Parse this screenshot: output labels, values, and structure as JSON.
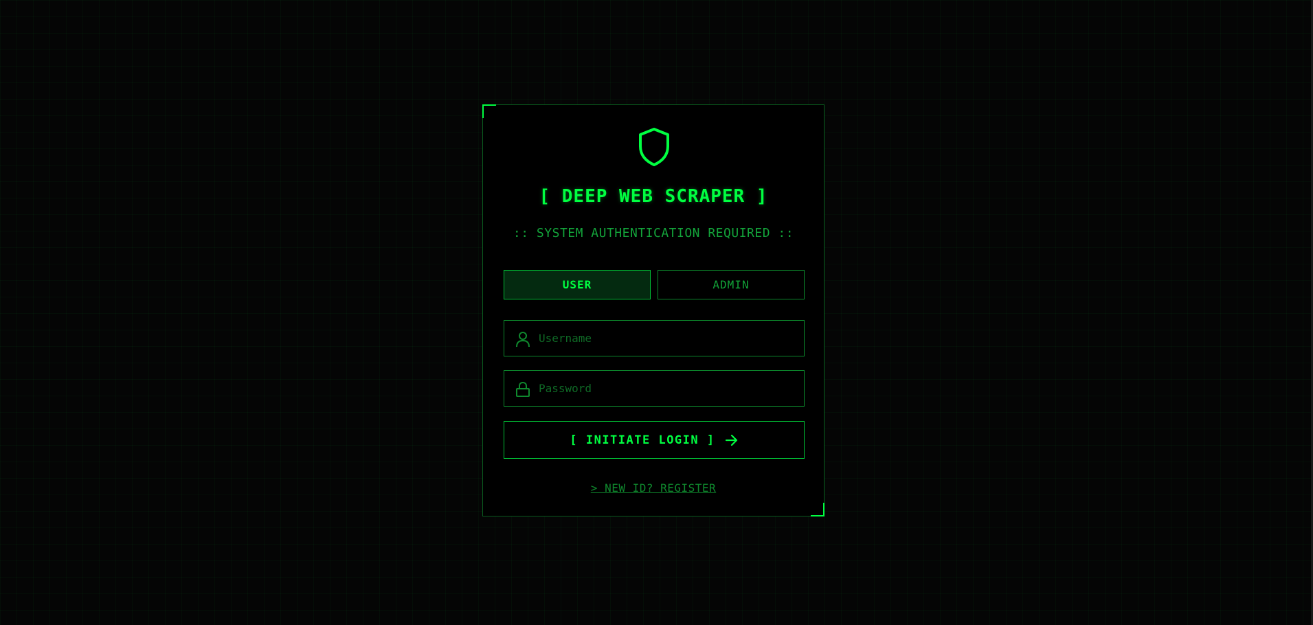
{
  "app": {
    "title": "[ DEEP WEB SCRAPER ]",
    "subtitle": ":: SYSTEM AUTHENTICATION REQUIRED ::"
  },
  "role_tabs": {
    "user_label": "USER",
    "admin_label": "ADMIN",
    "selected": "USER"
  },
  "form": {
    "username": {
      "placeholder": "Username",
      "value": "",
      "icon": "user-icon"
    },
    "password": {
      "placeholder": "Password",
      "value": "",
      "icon": "lock-icon"
    },
    "submit_label": "[ INITIATE LOGIN ]",
    "submit_icon": "arrow-right-icon"
  },
  "footer": {
    "register_link": "> NEW ID? REGISTER"
  },
  "theme": {
    "accent": "#00ff41",
    "accent_dim": "#0c8a2c",
    "background": "#050505"
  }
}
